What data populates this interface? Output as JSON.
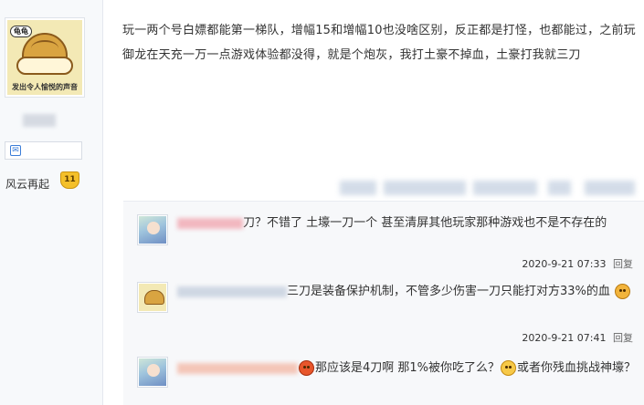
{
  "post": {
    "text": "玩一两个号白嫖都能第一梯队，增幅15和增幅10也没啥区别，反正都是打怪，也都能过，之前玩御龙在天充一万一点游戏体验都没得，就是个炮灰，我打土豪不掉血，土豪打我就三刀"
  },
  "user": {
    "avatar_tag": "龟龟",
    "avatar_caption": "发出令人愉悦的声音",
    "rank_label": "风云再起",
    "rank_level": "11"
  },
  "replies": [
    {
      "name_visible": "刀",
      "text_parts": [
        "？不错了 土壕一刀一个 甚至清屏其他玩家那种游戏也不是不存在的"
      ],
      "time": "2020-9-21 07:33",
      "reply_label": "回复",
      "avatar": "anime-girl-avatar"
    },
    {
      "name_visible": "丰...  回复  ...  :",
      "text_parts": [
        "三刀是装备保护机制，不管多少伤害一刀只能打对方33%的血"
      ],
      "time": "2020-9-21 07:41",
      "reply_label": "回复",
      "avatar": "turtle-avatar"
    },
    {
      "name_visible": "",
      "text_parts": [
        "那应该是4刀啊 那1%被你吃了么？",
        "或者你残血挑战神壕？"
      ],
      "avatar": "anime-girl-avatar"
    }
  ],
  "colors": {
    "accent": "#3b7dd8",
    "badge": "#f4c02a",
    "reply_bg": "#f7f8fa"
  }
}
